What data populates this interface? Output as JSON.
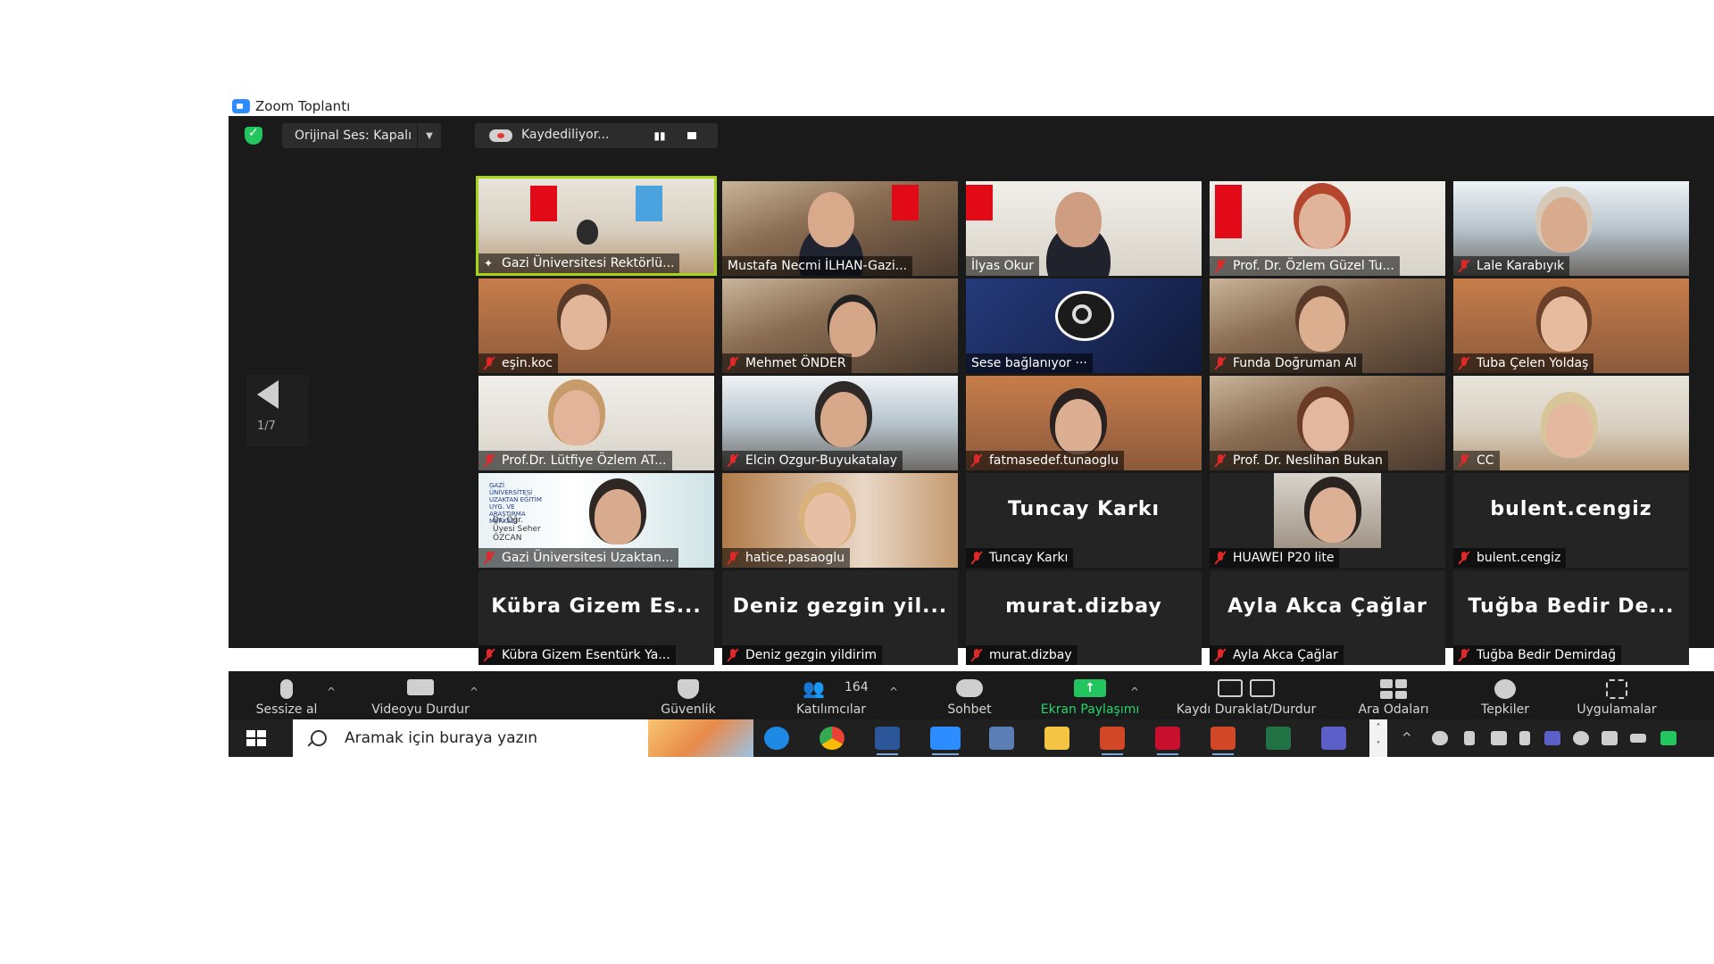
{
  "window": {
    "title": "Zoom Toplantı"
  },
  "topbar": {
    "audio_label": "Orijinal Ses: Kapalı",
    "recording_label": "Kaydediliyor..."
  },
  "pager": {
    "indicator": "1/7"
  },
  "participants": [
    {
      "name": "Gazi Üniversitesi Rektörlü...",
      "pinned": true,
      "muted": false,
      "big": ""
    },
    {
      "name": "Mustafa Necmi İLHAN-Gazi...",
      "pinned": false,
      "muted": false,
      "big": ""
    },
    {
      "name": "İlyas Okur",
      "pinned": false,
      "muted": false,
      "big": ""
    },
    {
      "name": "Prof. Dr. Özlem Güzel Tu...",
      "pinned": false,
      "muted": true,
      "big": ""
    },
    {
      "name": "Lale Karabıyık",
      "pinned": false,
      "muted": true,
      "big": ""
    },
    {
      "name": "eşin.koc",
      "pinned": false,
      "muted": true,
      "big": ""
    },
    {
      "name": "Mehmet ÖNDER",
      "pinned": false,
      "muted": true,
      "big": ""
    },
    {
      "name": "Sese bağlanıyor ···",
      "pinned": false,
      "muted": false,
      "big": ""
    },
    {
      "name": "Funda Doğruman Al",
      "pinned": false,
      "muted": true,
      "big": ""
    },
    {
      "name": "Tuba Çelen Yoldaş",
      "pinned": false,
      "muted": true,
      "big": ""
    },
    {
      "name": "Prof.Dr. Lütfiye Özlem AT...",
      "pinned": false,
      "muted": true,
      "big": ""
    },
    {
      "name": "Elcin Ozgur-Buyukatalay",
      "pinned": false,
      "muted": true,
      "big": ""
    },
    {
      "name": "fatmasedef.tunaoglu",
      "pinned": false,
      "muted": true,
      "big": ""
    },
    {
      "name": "Prof. Dr. Neslihan Bukan",
      "pinned": false,
      "muted": true,
      "big": ""
    },
    {
      "name": "CC",
      "pinned": false,
      "muted": true,
      "big": ""
    },
    {
      "name": "Gazi Üniversitesi Uzaktan...",
      "pinned": false,
      "muted": true,
      "big": ""
    },
    {
      "name": "hatice.pasaoglu",
      "pinned": false,
      "muted": true,
      "big": ""
    },
    {
      "name": "Tuncay Karkı",
      "pinned": false,
      "muted": true,
      "big": "Tuncay Karkı"
    },
    {
      "name": "HUAWEI P20 lite",
      "pinned": false,
      "muted": true,
      "big": ""
    },
    {
      "name": "bulent.cengiz",
      "pinned": false,
      "muted": true,
      "big": "bulent.cengiz"
    },
    {
      "name": "Kübra Gizem Esentürk Ya...",
      "pinned": false,
      "muted": true,
      "big": "Kübra Gizem Es..."
    },
    {
      "name": "Deniz gezgin yildirim",
      "pinned": false,
      "muted": true,
      "big": "Deniz gezgin yil..."
    },
    {
      "name": "murat.dizbay",
      "pinned": false,
      "muted": true,
      "big": "murat.dizbay"
    },
    {
      "name": "Ayla Akca Çağlar",
      "pinned": false,
      "muted": true,
      "big": "Ayla Akca Çağlar"
    },
    {
      "name": "Tuğba Bedir Demirdağ",
      "pinned": false,
      "muted": true,
      "big": "Tuğba Bedir De..."
    }
  ],
  "gazi_logo_text": "GAZİ ÜNİVERSİTESİ UZAKTAN EĞİTİM UYG. VE ARAŞTIRMA MERKEZİ",
  "gazi_badge": "Dr. Öğr. Üyesi Seher ÖZCAN",
  "toolbar": {
    "mute": "Sessize al",
    "video": "Videoyu Durdur",
    "security": "Güvenlik",
    "participants": "Katılımcılar",
    "participants_count": "164",
    "chat": "Sohbet",
    "share": "Ekran Paylaşımı",
    "record": "Kaydı Duraklat/Durdur",
    "breakout": "Ara Odaları",
    "reactions": "Tepkiler",
    "apps": "Uygulamalar"
  },
  "taskbar": {
    "search_placeholder": "Aramak için buraya yazın"
  },
  "colors": {
    "active_speaker": "#a8d418",
    "share_green": "#22c55e",
    "mute_red": "#e02828",
    "meeting_bg": "#1a1a1a"
  }
}
